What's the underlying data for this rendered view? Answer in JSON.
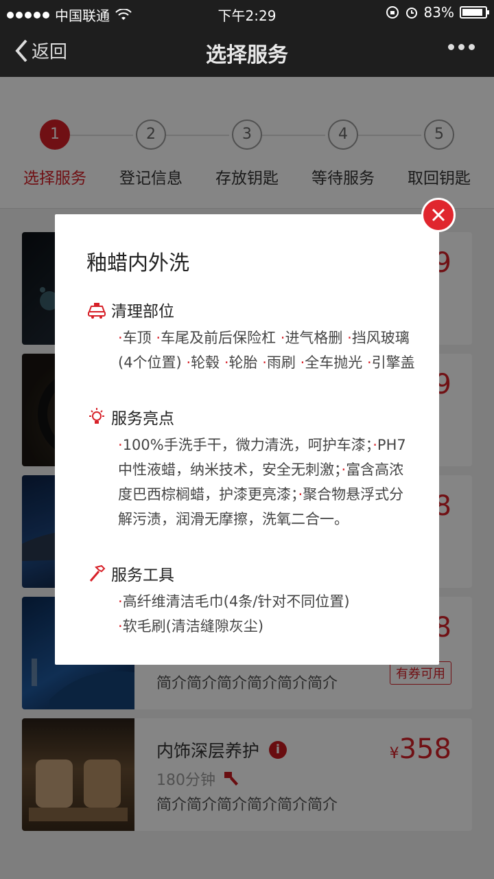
{
  "status_bar": {
    "carrier": "中国联通",
    "time": "下午2:29",
    "battery": "83%"
  },
  "nav": {
    "back_label": "返回",
    "title": "选择服务"
  },
  "steps": [
    {
      "num": "1",
      "label": "选择服务",
      "active": true
    },
    {
      "num": "2",
      "label": "登记信息",
      "active": false
    },
    {
      "num": "3",
      "label": "存放钥匙",
      "active": false
    },
    {
      "num": "4",
      "label": "等待服务",
      "active": false
    },
    {
      "num": "5",
      "label": "取回钥匙",
      "active": false
    }
  ],
  "cards": [
    {
      "price_tail": "9"
    },
    {
      "price_tail": "9"
    },
    {
      "price_tail": "8"
    },
    {
      "price_tail": "8",
      "desc": "简介简介简介简介简介简介",
      "coupon": "有券可用"
    },
    {
      "name": "内饰深层养护",
      "info": "i",
      "duration": "180分钟",
      "desc": "简介简介简介简介简介简介",
      "currency": "¥",
      "price": "358"
    }
  ],
  "modal": {
    "title": "釉蜡内外洗",
    "sections": [
      {
        "icon": "car-icon",
        "heading": "清理部位",
        "items": [
          "车顶",
          "车尾及前后保险杠",
          "进气格删",
          "挡风玻璃(4个位置)",
          "轮毂",
          "轮胎",
          "雨刷",
          "全车抛光",
          "引擎盖"
        ]
      },
      {
        "icon": "lightbulb-icon",
        "heading": "服务亮点",
        "items": [
          "100%手洗手干，微力清洗，呵护车漆；",
          "PH7中性液蜡，纳米技术，安全无刺激；",
          "富含高浓度巴西棕榈蜡，护漆更亮漆；",
          "聚合物悬浮式分解污渍，润滑无摩擦，洗氧二合一。"
        ]
      },
      {
        "icon": "tool-icon",
        "heading": "服务工具",
        "items": [
          "高纤维清洁毛巾(4条/针对不同位置)",
          "软毛刷(清洁缝隙灰尘)"
        ]
      }
    ]
  },
  "colors": {
    "accent": "#d72028",
    "nav_bg": "#1e1e1e"
  }
}
